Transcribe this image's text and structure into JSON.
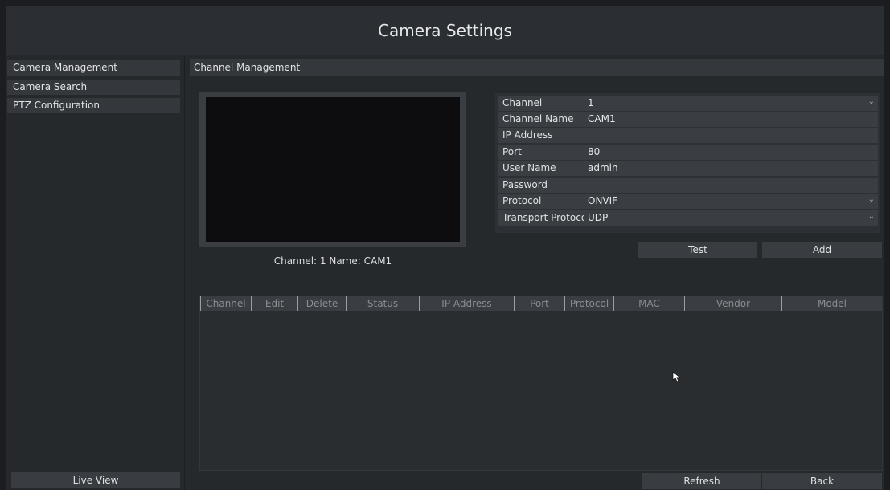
{
  "window": {
    "title": "Camera Settings"
  },
  "sidebar": {
    "items": [
      {
        "label": "Camera Management"
      },
      {
        "label": "Camera Search"
      },
      {
        "label": "PTZ Configuration"
      }
    ],
    "live_view_label": "Live View"
  },
  "main": {
    "section_title": "Channel Management",
    "preview_caption": "Channel: 1 Name: CAM1",
    "form": {
      "channel": {
        "label": "Channel",
        "value": "1"
      },
      "channel_name": {
        "label": "Channel Name",
        "value": "CAM1"
      },
      "ip_address": {
        "label": "IP Address",
        "value": ""
      },
      "port": {
        "label": "Port",
        "value": "80"
      },
      "user_name": {
        "label": "User Name",
        "value": "admin"
      },
      "password": {
        "label": "Password",
        "value": ""
      },
      "protocol": {
        "label": "Protocol",
        "value": "ONVIF"
      },
      "transport_protocol": {
        "label": "Transport Protocol",
        "value": "UDP"
      }
    },
    "test_label": "Test",
    "add_label": "Add",
    "table": {
      "columns": [
        "Channel",
        "Edit",
        "Delete",
        "Status",
        "IP Address",
        "Port",
        "Protocol",
        "MAC",
        "Vendor",
        "Model"
      ],
      "rows": []
    },
    "refresh_label": "Refresh",
    "back_label": "Back"
  },
  "colors": {
    "background": "#26292c",
    "panel": "#34373b",
    "field": "#3a3d41",
    "video": "#0d0d0f",
    "text": "#d8dadc"
  }
}
